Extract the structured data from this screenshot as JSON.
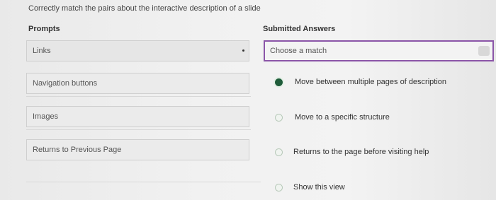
{
  "question": "Correctly match the pairs about the interactive description of a slide",
  "headers": {
    "prompts": "Prompts",
    "answers": "Submitted Answers"
  },
  "prompts": [
    "Links",
    "Navigation buttons",
    "Images",
    "Returns to Previous Page"
  ],
  "dropdown": {
    "placeholder": "Choose a match",
    "accent_color": "#8b55a8"
  },
  "options": [
    {
      "label": "Move between multiple pages of description",
      "selected": true
    },
    {
      "label": "Move to a specific structure",
      "selected": false
    },
    {
      "label": "Returns to the page before visiting help",
      "selected": false
    },
    {
      "label": "Show this view",
      "selected": false
    }
  ],
  "colors": {
    "radio_selected": "#1f5c3a",
    "dropdown_border": "#8b55a8"
  }
}
